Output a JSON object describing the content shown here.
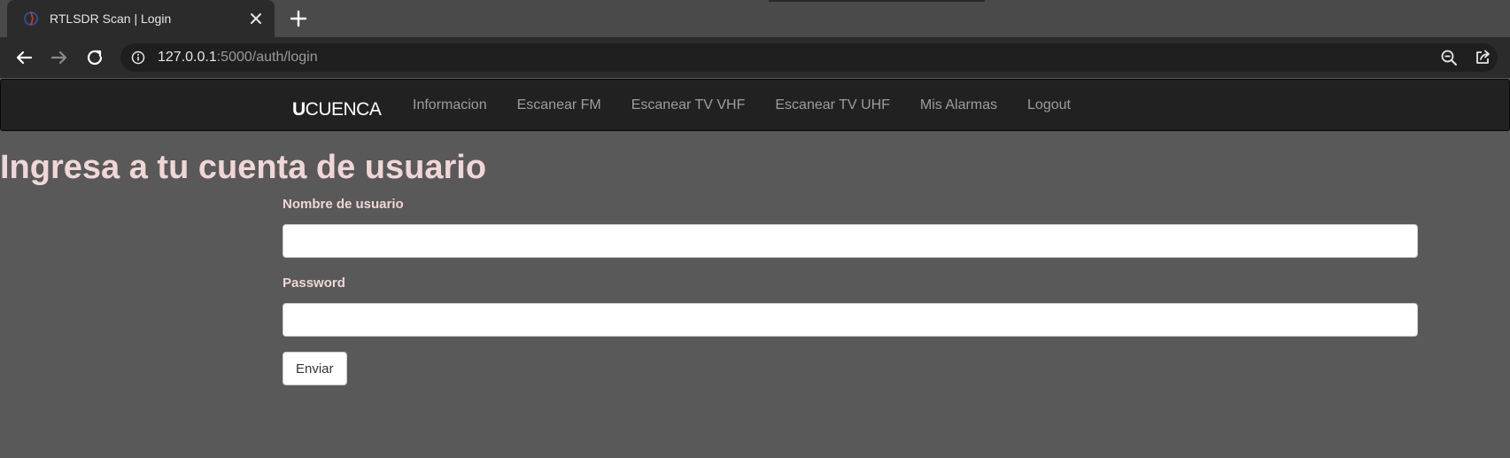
{
  "browser": {
    "tab": {
      "title": "RTLSDR Scan | Login"
    },
    "address": {
      "host": "127.0.0.1",
      "path": ":5000/auth/login"
    }
  },
  "navbar": {
    "brand_bold": "U",
    "brand_rest": "CUENCA",
    "items": [
      "Informacion",
      "Escanear FM",
      "Escanear TV VHF",
      "Escanear TV UHF",
      "Mis Alarmas",
      "Logout"
    ]
  },
  "page": {
    "title": "Ingresa a tu cuenta de usuario",
    "form": {
      "username_label": "Nombre de usuario",
      "username_value": "",
      "password_label": "Password",
      "password_value": "",
      "submit_label": "Enviar"
    }
  },
  "icons": {
    "favicon": "rtlsdr-favicon",
    "close": "close-icon",
    "new_tab": "plus-icon",
    "back": "arrow-left-icon",
    "forward": "arrow-right-icon",
    "reload": "reload-icon",
    "site_info": "info-icon",
    "zoom": "zoom-out-icon",
    "share": "share-icon"
  },
  "colors": {
    "page_background": "#595959",
    "navbar": "#212121",
    "heading": "#f0d6d6",
    "nav_link": "#9d9d9d"
  }
}
